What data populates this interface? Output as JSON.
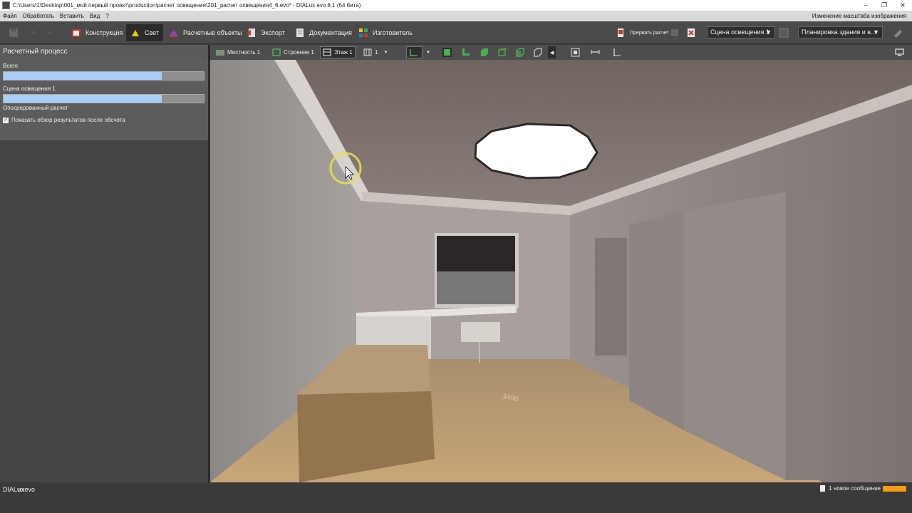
{
  "window": {
    "title": "C:\\Users\\1\\Desktop\\001_мой первый проект\\production\\расчет освещения\\201_расчет освещения4_6.evo* - DIALux evo 8.1 (64 бита)",
    "minimize": "–",
    "restore": "❐",
    "close": "✕"
  },
  "menu": {
    "items": [
      "Файл",
      "Обработать",
      "Вставить",
      "Вид",
      "?"
    ],
    "right": "Изменение масштаба изображения"
  },
  "toolbar": {
    "modes": [
      "Конструкция",
      "Свет",
      "Расчетные объекты",
      "Экспорт",
      "Документация",
      "Изготовитель"
    ],
    "active_mode": "Свет",
    "stop_label": "Прервать расчет",
    "scene_select": "Сцена освещения 1",
    "layout_select": "Планировка здания и в...",
    "dropdown_arrow": "▼"
  },
  "left_panel": {
    "title": "Расчетный процесс",
    "total_label": "Всего",
    "total_progress": 0.79,
    "scene_label": "Сцена освещения 1",
    "scene_progress": 0.79,
    "indirect_label": "Опосредованный расчет",
    "checkbox_label": "Показать обзор результатов после обсчета",
    "checkbox_checked": true,
    "check_mark": "✓"
  },
  "view_toolbar": {
    "site": "Местность 1",
    "building": "Строение 1",
    "storey": "Этаж 1",
    "level": "1",
    "arrow": "▼",
    "collapse": "◀"
  },
  "viewport": {
    "floor_dimension": "3490"
  },
  "status": {
    "brand_left": "DIAL",
    "brand_bold": "ux",
    "brand_right": "evo",
    "message": "1 новое сообщение"
  },
  "colors": {
    "accent_orange": "#f39c12",
    "progress_fill": "#a8cff5",
    "active_green": "#4caf50"
  }
}
